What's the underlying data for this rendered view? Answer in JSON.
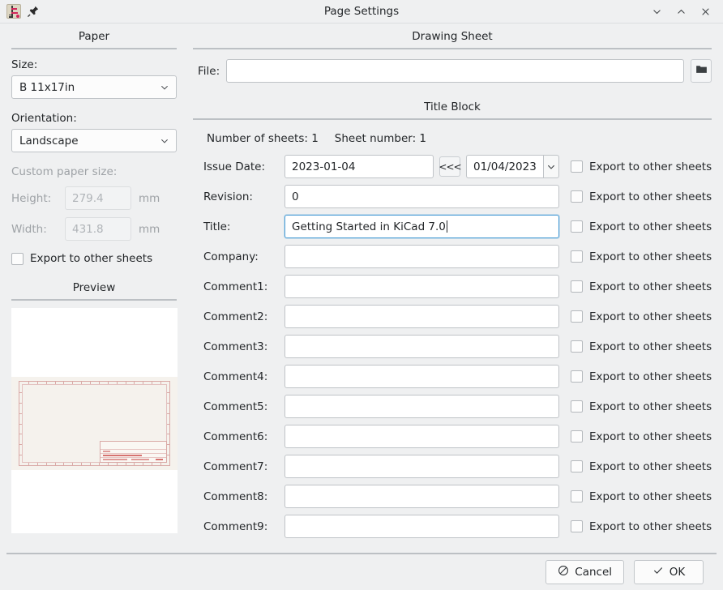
{
  "window": {
    "title": "Page Settings",
    "app_icon": "kicad-schematic-icon",
    "pin_icon": "pin-icon",
    "minimize_icon": "chevron-down-icon",
    "maximize_icon": "chevron-up-icon",
    "close_icon": "close-icon"
  },
  "paper": {
    "section_title": "Paper",
    "size_label": "Size:",
    "size_value": "B 11x17in",
    "orientation_label": "Orientation:",
    "orientation_value": "Landscape",
    "custom_label": "Custom paper size:",
    "height_label": "Height:",
    "height_value": "279.4",
    "height_unit": "mm",
    "width_label": "Width:",
    "width_value": "431.8",
    "width_unit": "mm",
    "export_label": "Export to other sheets"
  },
  "preview": {
    "section_title": "Preview"
  },
  "drawing_sheet": {
    "section_title": "Drawing Sheet",
    "file_label": "File:",
    "file_value": "",
    "file_placeholder": "",
    "browse_icon": "folder-icon"
  },
  "title_block": {
    "section_title": "Title Block",
    "number_of_sheets": "Number of sheets: 1",
    "sheet_number": "Sheet number: 1",
    "export_label": "Export to other sheets",
    "issue_date": {
      "label": "Issue Date:",
      "value": "2023-01-04",
      "apply_button": "<<<",
      "picker_value": "01/04/2023",
      "picker_icon": "chevron-down-icon"
    },
    "fields": [
      {
        "label": "Revision:",
        "value": "0",
        "focused": false
      },
      {
        "label": "Title:",
        "value": "Getting Started in KiCad 7.0",
        "focused": true
      },
      {
        "label": "Company:",
        "value": "",
        "focused": false
      },
      {
        "label": "Comment1:",
        "value": "",
        "focused": false
      },
      {
        "label": "Comment2:",
        "value": "",
        "focused": false
      },
      {
        "label": "Comment3:",
        "value": "",
        "focused": false
      },
      {
        "label": "Comment4:",
        "value": "",
        "focused": false
      },
      {
        "label": "Comment5:",
        "value": "",
        "focused": false
      },
      {
        "label": "Comment6:",
        "value": "",
        "focused": false
      },
      {
        "label": "Comment7:",
        "value": "",
        "focused": false
      },
      {
        "label": "Comment8:",
        "value": "",
        "focused": false
      },
      {
        "label": "Comment9:",
        "value": "",
        "focused": false
      }
    ]
  },
  "footer": {
    "cancel_label": "Cancel",
    "cancel_icon": "prohibited-icon",
    "ok_label": "OK",
    "ok_icon": "check-icon"
  },
  "colors": {
    "dialog_bg": "#eff0f1",
    "field_bg": "#ffffff",
    "border": "#bfc3c7",
    "focus_border": "#4d9ed6",
    "rule": "#bcc0c4",
    "sheet_fill": "#f5f2ed",
    "sheet_line": "#d9a9a6"
  }
}
